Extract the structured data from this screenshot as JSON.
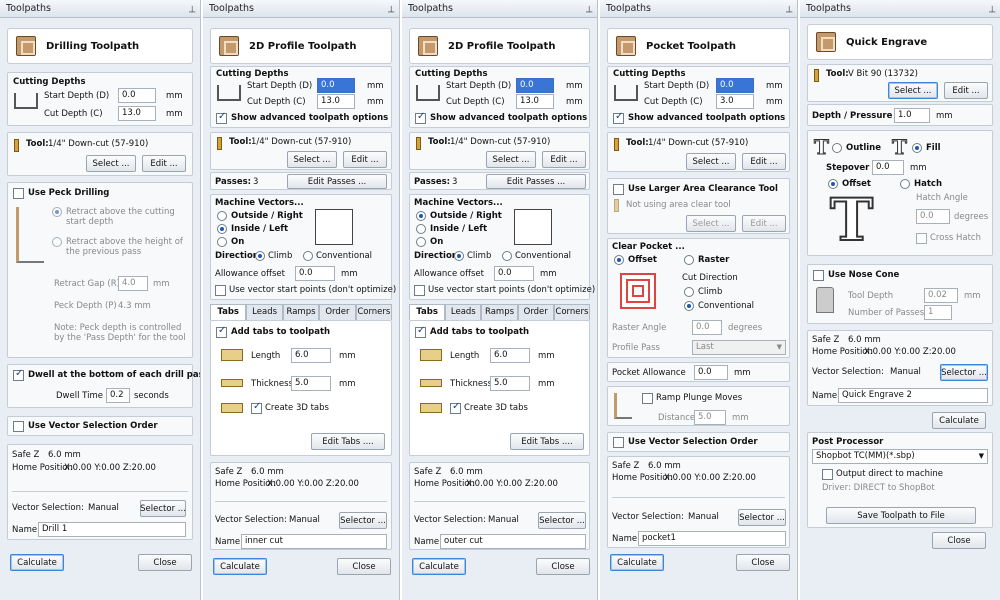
{
  "common": {
    "header": "Toolpaths",
    "cutting_depths": "Cutting Depths",
    "start_depth": "Start Depth (D)",
    "cut_depth": "Cut Depth (C)",
    "mm": "mm",
    "tool_label": "Tool:",
    "tool_name": "1/4\" Down-cut (57-910)",
    "select_btn": "Select ...",
    "edit_btn": "Edit ...",
    "show_advanced": "Show advanced toolpath options",
    "passes_label": "Passes:",
    "edit_passes": "Edit Passes ...",
    "machine_vectors": "Machine Vectors...",
    "outside_right": "Outside / Right",
    "inside_left": "Inside / Left",
    "on": "On",
    "direction": "Direction",
    "climb": "Climb",
    "conventional": "Conventional",
    "allowance_offset": "Allowance offset",
    "use_vector_start": "Use vector start points (don't optimize)",
    "tabs": [
      "Tabs",
      "Leads",
      "Ramps",
      "Order",
      "Corners"
    ],
    "add_tabs": "Add tabs to toolpath",
    "length": "Length",
    "thickness": "Thickness",
    "create_3d": "Create 3D tabs",
    "edit_tabs": "Edit Tabs ....",
    "safe_z": "Safe Z",
    "safe_z_val": "6.0 mm",
    "home_position": "Home Position",
    "home_val": "X:0.00 Y:0.00 Z:20.00",
    "vector_selection": "Vector Selection:",
    "manual": "Manual",
    "selector_btn": "Selector ...",
    "name_label": "Name:",
    "calculate": "Calculate",
    "close": "Close",
    "use_vector_sel_order": "Use Vector Selection Order"
  },
  "p1": {
    "title": "Drilling Toolpath",
    "start": "0.0",
    "cut": "13.0",
    "use_peck": "Use Peck Drilling",
    "retract_start": "Retract above the cutting start depth",
    "retract_prev": "Retract above the height of the previous pass",
    "retract_gap": "Retract Gap (R)",
    "retract_gap_val": "4.0",
    "peck_depth": "Peck Depth (P)",
    "peck_val": "4.3 mm",
    "note": "Note: Peck depth is controlled by the 'Pass Depth' for the tool",
    "dwell": "Dwell at the bottom of each drill pass",
    "dwell_time": "Dwell Time",
    "dwell_val": "0.2",
    "seconds": "seconds",
    "name": "Drill 1"
  },
  "p2": {
    "title": "2D Profile Toolpath",
    "start": "0.0",
    "cut": "13.0",
    "passes": "3",
    "allowance": "0.0",
    "length": "6.0",
    "thickness": "5.0",
    "name": "inner cut"
  },
  "p3": {
    "title": "2D Profile Toolpath",
    "start": "0.0",
    "cut": "13.0",
    "passes": "3",
    "allowance": "0.0",
    "length": "6.0",
    "thickness": "5.0",
    "name": "outer cut"
  },
  "p4": {
    "title": "Pocket Toolpath",
    "start": "0.0",
    "cut": "3.0",
    "larger_area": "Use Larger Area Clearance Tool",
    "not_using": "Not using area clear tool",
    "clear_pocket": "Clear Pocket ...",
    "offset": "Offset",
    "raster": "Raster",
    "cut_direction": "Cut Direction",
    "raster_angle": "Raster Angle",
    "raster_val": "0.0",
    "degrees": "degrees",
    "profile_pass": "Profile Pass",
    "profile_val": "Last",
    "pocket_allowance": "Pocket Allowance",
    "pocket_val": "0.0",
    "ramp_plunge": "Ramp Plunge Moves",
    "distance": "Distance",
    "distance_val": "5.0",
    "name": "pocket1"
  },
  "p5": {
    "title": "Quick Engrave",
    "tool_name": "V Bit 90 (13732)",
    "edit": "Edit ...",
    "depth_pressure": "Depth / Pressure",
    "depth_val": "1.0",
    "outline": "Outline",
    "fill": "Fill",
    "stepover": "Stepover",
    "stepover_val": "0.0",
    "offset": "Offset",
    "hatch": "Hatch",
    "hatch_angle": "Hatch Angle",
    "hatch_val": "0.0",
    "degrees": "degrees",
    "cross_hatch": "Cross Hatch",
    "nose_cone": "Use Nose Cone",
    "tool_depth": "Tool Depth",
    "tool_depth_val": "0.02",
    "num_passes": "Number of Passes",
    "num_passes_val": "1",
    "name": "Quick Engrave 2",
    "post_processor": "Post Processor",
    "pp_value": "Shopbot TC(MM)(*.sbp)",
    "output_direct": "Output direct to machine",
    "driver": "Driver: DIRECT to ShopBot",
    "save_toolpath": "Save Toolpath to File"
  }
}
